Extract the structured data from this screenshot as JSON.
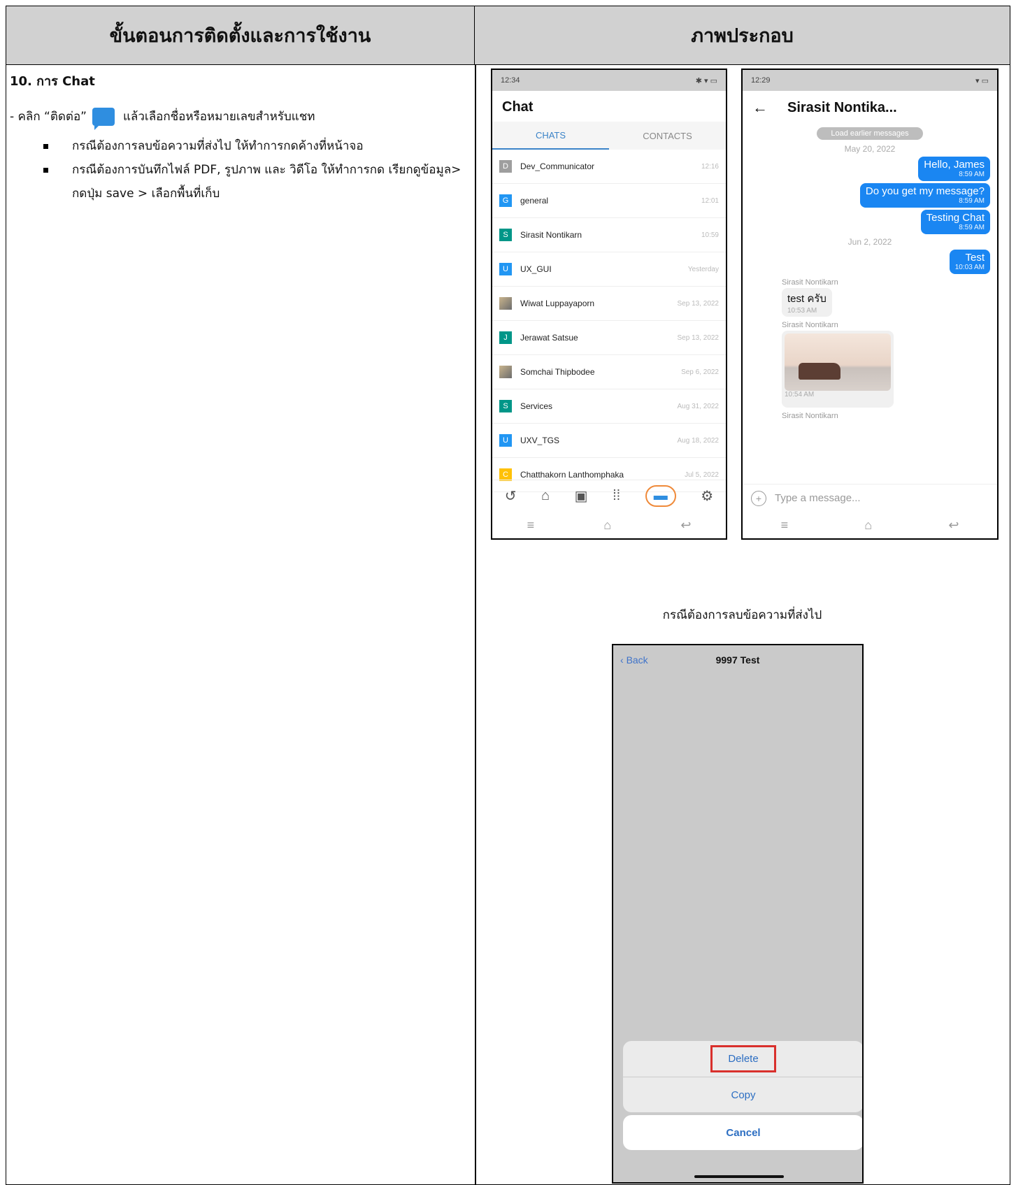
{
  "table": {
    "col1_header": "ขั้นตอนการติดตั้งและการใช้งาน",
    "col2_header": "ภาพประกอบ"
  },
  "steps": {
    "heading": "10. การ Chat",
    "intro_prefix": "- คลิก “ติดต่อ”",
    "intro_suffix": "แล้วเลือกชื่อหรือหมายเลขสำหรับแชท",
    "bullets": [
      "กรณีต้องการลบข้อความที่ส่งไป ให้ทำการกดค้างที่หน้าจอ",
      "กรณีต้องการบันทึกไฟล์ PDF, รูปภาพ และ วิดีโอ ให้ทำการกด เรียกดูข้อมูล> กดปุ่ม save > เลือกพื้นที่เก็บ"
    ]
  },
  "phone1": {
    "status_time": "12:34",
    "title": "Chat",
    "tab_chats": "CHATS",
    "tab_contacts": "CONTACTS",
    "chats": [
      {
        "initial": "D",
        "color": "#9e9e9e",
        "name": "Dev_Communicator",
        "time": "12:16"
      },
      {
        "initial": "G",
        "color": "#2196f3",
        "name": "general",
        "time": "12:01"
      },
      {
        "initial": "S",
        "color": "#009688",
        "name": "Sirasit Nontikarn",
        "time": "10:59"
      },
      {
        "initial": "U",
        "color": "#2196f3",
        "name": "UX_GUI",
        "time": "Yesterday"
      },
      {
        "initial": "",
        "color": "",
        "name": "Wiwat Luppayaporn",
        "time": "Sep 13, 2022"
      },
      {
        "initial": "J",
        "color": "#009688",
        "name": "Jerawat Satsue",
        "time": "Sep 13, 2022"
      },
      {
        "initial": "",
        "color": "",
        "name": "Somchai Thipbodee",
        "time": "Sep 6, 2022"
      },
      {
        "initial": "S",
        "color": "#009688",
        "name": "Services",
        "time": "Aug 31, 2022"
      },
      {
        "initial": "U",
        "color": "#2196f3",
        "name": "UXV_TGS",
        "time": "Aug 18, 2022"
      },
      {
        "initial": "C",
        "color": "#ffc107",
        "name": "Chatthakorn Lanthomphaka",
        "time": "Jul 5, 2022"
      }
    ]
  },
  "phone2": {
    "status_time": "12:29",
    "title": "Sirasit Nontika...",
    "load_earlier": "Load earlier messages",
    "date1": "May 20, 2022",
    "msg1": "Hello, James",
    "msg1_time": "8:59 AM",
    "msg2": "Do you get my message?",
    "msg2_time": "8:59 AM",
    "msg3": "Testing Chat",
    "msg3_time": "8:59 AM",
    "date2": "Jun 2, 2022",
    "msg4": "Test",
    "msg4_time": "10:03 AM",
    "sender": "Sirasit Nontikarn",
    "msg5": "test ครับ",
    "msg5_time": "10:53 AM",
    "img_time": "10:54 AM",
    "input_placeholder": "Type a message..."
  },
  "caption": "กรณีต้องการลบข้อความที่ส่งไป",
  "ios": {
    "back": "Back",
    "title": "9997 Test",
    "delete": "Delete",
    "copy": "Copy",
    "cancel": "Cancel"
  }
}
